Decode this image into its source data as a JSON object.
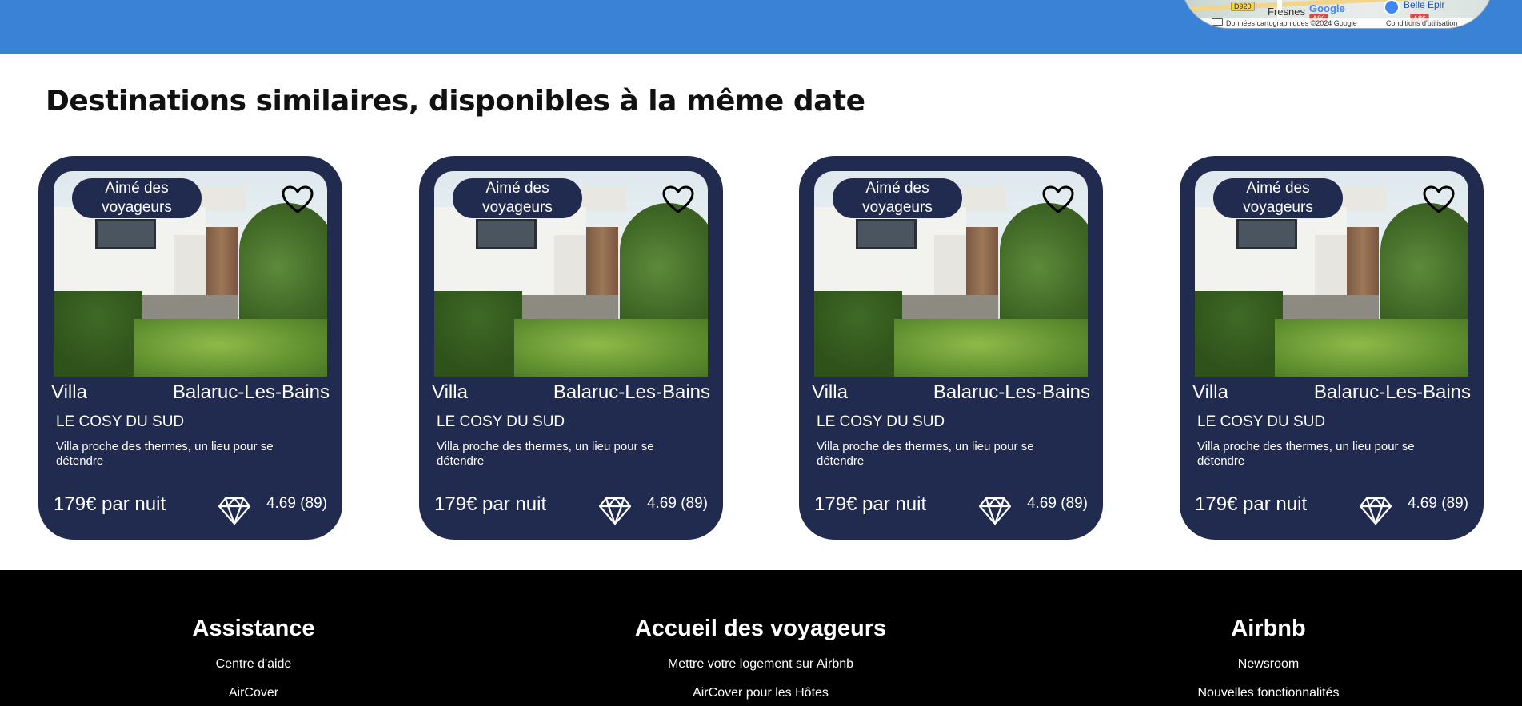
{
  "map": {
    "road_badge": "D920",
    "town": "Fresnes",
    "google": "Google",
    "place": "Belle Epir",
    "attribution": "Données cartographiques ©2024 Google",
    "terms": "Conditions d'utilisation",
    "highway_badge": "A86"
  },
  "section": {
    "title": "Destinations similaires, disponibles à la même date"
  },
  "cards": [
    {
      "badge": "Aimé des voyageurs",
      "type": "Villa",
      "city": "Balaruc-Les-Bains",
      "name": "LE COSY DU SUD",
      "description": "Villa proche des thermes, un lieu pour se détendre",
      "price": "179€ par nuit",
      "rating": "4.69 (89)"
    },
    {
      "badge": "Aimé des voyageurs",
      "type": "Villa",
      "city": "Balaruc-Les-Bains",
      "name": "LE COSY DU SUD",
      "description": "Villa proche des thermes, un lieu pour se détendre",
      "price": "179€ par nuit",
      "rating": "4.69 (89)"
    },
    {
      "badge": "Aimé des voyageurs",
      "type": "Villa",
      "city": "Balaruc-Les-Bains",
      "name": "LE COSY DU SUD",
      "description": "Villa proche des thermes, un lieu pour se détendre",
      "price": "179€ par nuit",
      "rating": "4.69 (89)"
    },
    {
      "badge": "Aimé des voyageurs",
      "type": "Villa",
      "city": "Balaruc-Les-Bains",
      "name": "LE COSY DU SUD",
      "description": "Villa proche des thermes, un lieu pour se détendre",
      "price": "179€ par nuit",
      "rating": "4.69 (89)"
    }
  ],
  "footer": {
    "columns": [
      {
        "heading": "Assistance",
        "links": [
          "Centre d'aide",
          "AirCover"
        ]
      },
      {
        "heading": "Accueil des voyageurs",
        "links": [
          "Mettre votre logement sur Airbnb",
          "AirCover pour les Hôtes"
        ]
      },
      {
        "heading": "Airbnb",
        "links": [
          "Newsroom",
          "Nouvelles fonctionnalités"
        ]
      }
    ]
  },
  "colors": {
    "band": "#3a82d6",
    "card": "#212b4f",
    "footer": "#000000"
  },
  "icons": {
    "favorite": "heart-icon",
    "rating": "diamond-icon"
  }
}
